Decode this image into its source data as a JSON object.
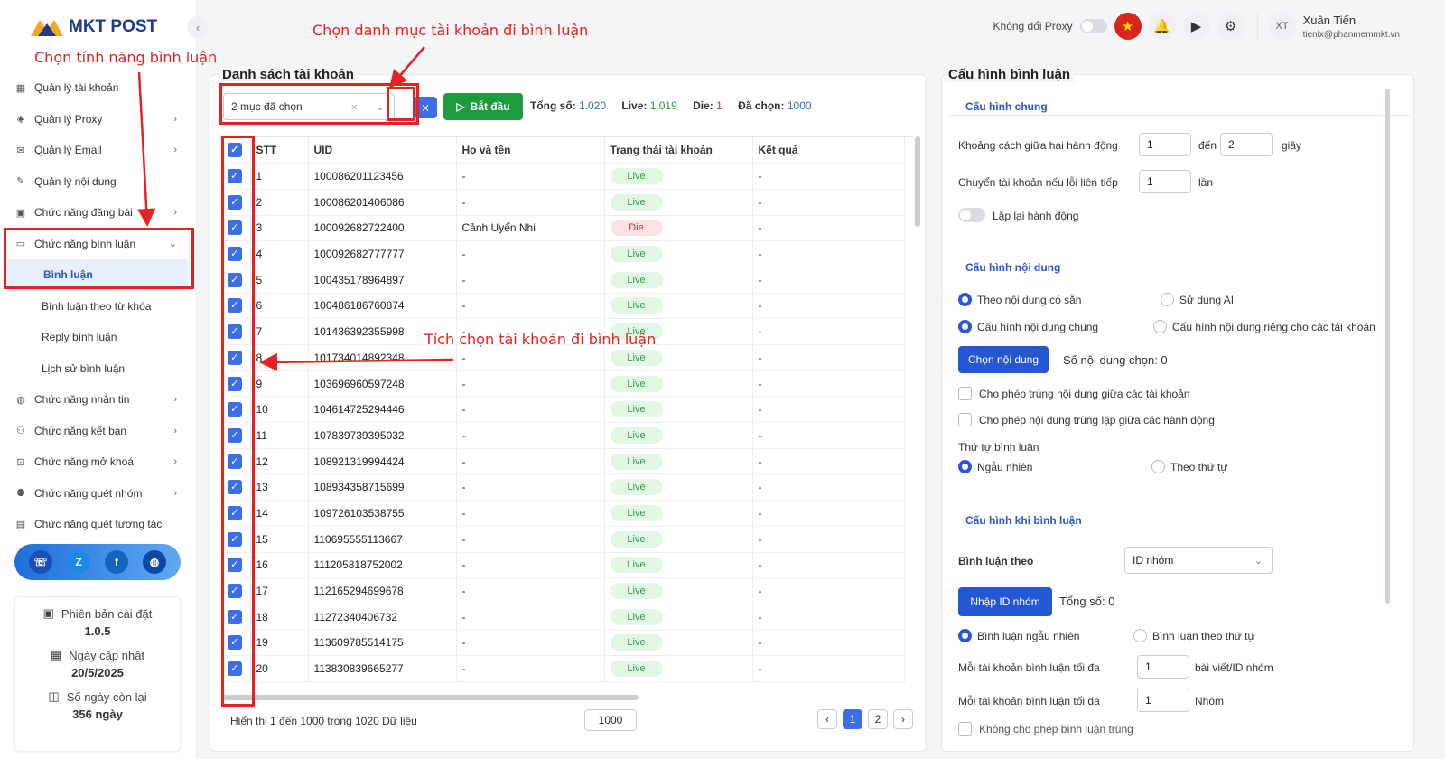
{
  "app": {
    "logo_text": "MKT POST",
    "collapse_glyph": "‹"
  },
  "sidebar": {
    "items": [
      {
        "label": "Quản lý tài khoản",
        "icon": "grid-icon",
        "glyph": "▦",
        "chev": ""
      },
      {
        "label": "Quản lý Proxy",
        "icon": "layers-icon",
        "glyph": "◈",
        "chev": "›"
      },
      {
        "label": "Quản lý Email",
        "icon": "mail-icon",
        "glyph": "✉",
        "chev": "›"
      },
      {
        "label": "Quản lý nội dung",
        "icon": "wand-icon",
        "glyph": "✎",
        "chev": ""
      },
      {
        "label": "Chức năng đăng bài",
        "icon": "post-icon",
        "glyph": "▣",
        "chev": "›"
      },
      {
        "label": "Chức năng bình luận",
        "icon": "comment-icon",
        "glyph": "▭",
        "chev": "⌄"
      }
    ],
    "sub_items": [
      "Bình luận",
      "Bình luận theo từ khóa",
      "Reply bình luận",
      "Lịch sử bình luận"
    ],
    "items2": [
      {
        "label": "Chức năng nhắn tin",
        "icon": "chat-icon",
        "glyph": "◍",
        "chev": "›"
      },
      {
        "label": "Chức năng kết bạn",
        "icon": "add-friend-icon",
        "glyph": "⚇",
        "chev": "›"
      },
      {
        "label": "Chức năng mở khoá",
        "icon": "lock-icon",
        "glyph": "⊡",
        "chev": "›"
      },
      {
        "label": "Chức năng quét nhóm",
        "icon": "group-icon",
        "glyph": "⚉",
        "chev": "›"
      },
      {
        "label": "Chức năng quét tương tác",
        "icon": "scan-icon",
        "glyph": "▤",
        "chev": ""
      }
    ],
    "social": [
      {
        "name": "support-icon",
        "glyph": "☏",
        "color": "#1a4fb8"
      },
      {
        "name": "zalo-icon",
        "glyph": "Z",
        "color": "#1e88e5"
      },
      {
        "name": "facebook-icon",
        "glyph": "f",
        "color": "#1565c0"
      },
      {
        "name": "globe-icon",
        "glyph": "◍",
        "color": "#0d47a1"
      }
    ],
    "info": {
      "version_label": "Phiên bản cài đặt",
      "version": "1.0.5",
      "update_label": "Ngày cập nhật",
      "update": "20/5/2025",
      "days_label": "Số ngày còn lại",
      "days": "356 ngày"
    }
  },
  "topbar": {
    "proxy_label": "Không đổi Proxy",
    "user_initials": "XT",
    "user_name": "Xuân Tiến",
    "user_email": "tienlx@phanmemmkt.vn",
    "flag_glyph": "★",
    "bell_glyph": "🔔",
    "play_glyph": "▶",
    "gear_glyph": "⚙"
  },
  "accounts": {
    "title": "Danh sách tài khoản",
    "filter_value": "2 mục đã chọn",
    "clear_glyph": "×",
    "dropdown_glyph": "⌄",
    "filter_icon_glyph": "⨯",
    "start_label": "Bắt đầu",
    "start_glyph": "▷",
    "total_label": "Tổng số:",
    "total": "1.020",
    "live_label": "Live:",
    "live": "1.019",
    "die_label": "Die:",
    "die": "1",
    "selected_label": "Đã chọn:",
    "selected": "1000",
    "columns": [
      "STT",
      "UID",
      "Họ và tên",
      "Trạng thái tài khoản",
      "Kết quả"
    ],
    "check_glyph": "✓",
    "rows": [
      {
        "stt": "1",
        "uid": "100086201123456",
        "name": "-",
        "status": "Live",
        "result": "-"
      },
      {
        "stt": "2",
        "uid": "100086201406086",
        "name": "-",
        "status": "Live",
        "result": "-"
      },
      {
        "stt": "3",
        "uid": "100092682722400",
        "name": "Cảnh Uyển Nhi",
        "status": "Die",
        "result": "-"
      },
      {
        "stt": "4",
        "uid": "100092682777777",
        "name": "-",
        "status": "Live",
        "result": "-"
      },
      {
        "stt": "5",
        "uid": "100435178964897",
        "name": "-",
        "status": "Live",
        "result": "-"
      },
      {
        "stt": "6",
        "uid": "100486186760874",
        "name": "-",
        "status": "Live",
        "result": "-"
      },
      {
        "stt": "7",
        "uid": "101436392355998",
        "name": "-",
        "status": "Live",
        "result": "-"
      },
      {
        "stt": "8",
        "uid": "101734014892348",
        "name": "-",
        "status": "Live",
        "result": "-"
      },
      {
        "stt": "9",
        "uid": "103696960597248",
        "name": "-",
        "status": "Live",
        "result": "-"
      },
      {
        "stt": "10",
        "uid": "104614725294446",
        "name": "-",
        "status": "Live",
        "result": "-"
      },
      {
        "stt": "11",
        "uid": "107839739395032",
        "name": "-",
        "status": "Live",
        "result": "-"
      },
      {
        "stt": "12",
        "uid": "108921319994424",
        "name": "-",
        "status": "Live",
        "result": "-"
      },
      {
        "stt": "13",
        "uid": "108934358715699",
        "name": "-",
        "status": "Live",
        "result": "-"
      },
      {
        "stt": "14",
        "uid": "109726103538755",
        "name": "-",
        "status": "Live",
        "result": "-"
      },
      {
        "stt": "15",
        "uid": "110695555113667",
        "name": "-",
        "status": "Live",
        "result": "-"
      },
      {
        "stt": "16",
        "uid": "111205818752002",
        "name": "-",
        "status": "Live",
        "result": "-"
      },
      {
        "stt": "17",
        "uid": "112165294699678",
        "name": "-",
        "status": "Live",
        "result": "-"
      },
      {
        "stt": "18",
        "uid": "11272340406732",
        "name": "-",
        "status": "Live",
        "result": "-"
      },
      {
        "stt": "19",
        "uid": "113609785514175",
        "name": "-",
        "status": "Live",
        "result": "-"
      },
      {
        "stt": "20",
        "uid": "113830839665277",
        "name": "-",
        "status": "Live",
        "result": "-"
      }
    ],
    "footer_text": "Hiển thị 1 đến 1000 trong 1020 Dữ liệu",
    "page_size": "1000",
    "pages": [
      "‹",
      "1",
      "2",
      "›"
    ]
  },
  "config": {
    "title": "Cấu hình bình luận",
    "general_title": "Cấu hình chung",
    "interval_label": "Khoảng cách giữa hai hành động",
    "interval_from": "1",
    "interval_to_label": "đến",
    "interval_to": "2",
    "interval_unit": "giây",
    "switch_label": "Chuyển tài khoản nếu lỗi liên tiếp",
    "switch_value": "1",
    "switch_unit": "lần",
    "repeat_label": "Lặp lại hành động",
    "content_title": "Cấu hình nội dung",
    "opt_available": "Theo nội dung có sẵn",
    "opt_ai": "Sử dụng AI",
    "opt_common": "Cấu hình nội dung chung",
    "opt_private": "Cấu hình nội dung riêng cho các tài khoản",
    "choose_content": "Chọn nội dung",
    "content_count": "Số nội dung chọn: 0",
    "allow_dup_accounts": "Cho phép trùng nội dung giữa các tài khoản",
    "allow_dup_actions": "Cho phép nội dung trùng lặp giữa các hành động",
    "order_label": "Thứ tự bình luận",
    "order_random": "Ngẫu nhiên",
    "order_seq": "Theo thứ tự",
    "comment_title": "Cấu hình khi bình luận",
    "comment_by_label": "Bình luận theo",
    "comment_by_value": "ID nhóm",
    "import_ids": "Nhập ID nhóm",
    "ids_total": "Tổng số: 0",
    "random_comment": "Bình luận ngẫu nhiên",
    "seq_comment": "Bình luận theo thứ tự",
    "max_label_1": "Mỗi tài khoản bình luận tối đa",
    "max_value_1": "1",
    "max_unit_1": "bài viết/ID nhóm",
    "max_label_2": "Mỗi tài khoản bình luận tối đa",
    "max_value_2": "1",
    "max_unit_2": "Nhóm",
    "cut_label": "Không cho phép bình luận trùng"
  },
  "annotations": {
    "a1": "Chọn tính năng bình luận",
    "a2": "Chọn danh mục tài khoản đi bình luận",
    "a3": "Tích chọn tài khoản đi bình luận",
    "color": "#e52222"
  }
}
